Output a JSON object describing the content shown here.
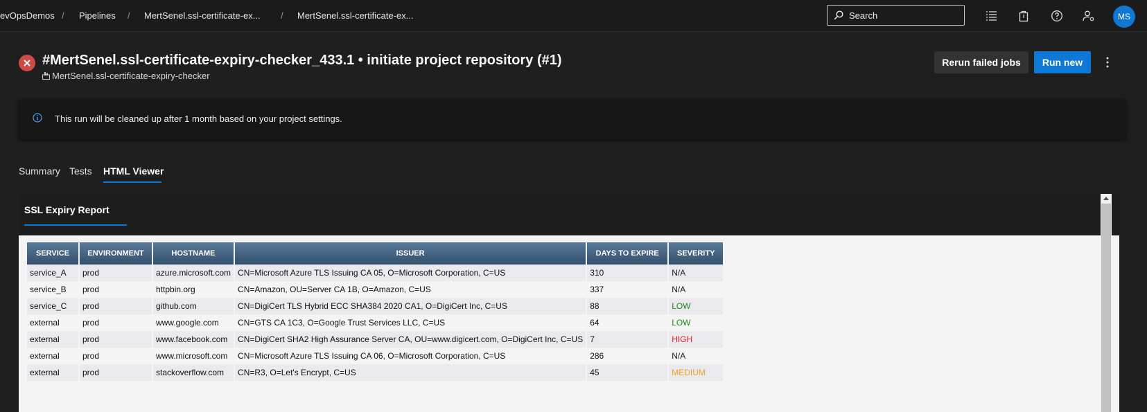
{
  "breadcrumb": {
    "items": [
      "evOpsDemos",
      "Pipelines",
      "MertSenel.ssl-certificate-ex...",
      "MertSenel.ssl-certificate-ex..."
    ],
    "separator": "/"
  },
  "topbar": {
    "search_label": "Search",
    "icons": [
      "list-settings-icon",
      "shopping-bag-icon",
      "help-icon",
      "user-settings-icon"
    ],
    "avatar_initials": "MS"
  },
  "run": {
    "status": "failed",
    "title": "#MertSenel.ssl-certificate-expiry-checker_433.1 • initiate project repository (#1)",
    "repo": "MertSenel.ssl-certificate-expiry-checker"
  },
  "actions": {
    "rerun_label": "Rerun failed jobs",
    "run_new_label": "Run new"
  },
  "banner": {
    "message": "This run will be cleaned up after 1 month based on your project settings."
  },
  "tabs": [
    {
      "label": "Summary",
      "active": false
    },
    {
      "label": "Tests",
      "active": false
    },
    {
      "label": "HTML Viewer",
      "active": true
    }
  ],
  "report": {
    "title": "SSL Expiry Report",
    "columns": [
      "SERVICE",
      "ENVIRONMENT",
      "HOSTNAME",
      "ISSUER",
      "DAYS TO EXPIRE",
      "SEVERITY"
    ],
    "rows": [
      [
        "service_A",
        "prod",
        "azure.microsoft.com",
        "CN=Microsoft Azure TLS Issuing CA 05, O=Microsoft Corporation, C=US",
        "310",
        "N/A"
      ],
      [
        "service_B",
        "prod",
        "httpbin.org",
        "CN=Amazon, OU=Server CA 1B, O=Amazon, C=US",
        "337",
        "N/A"
      ],
      [
        "service_C",
        "prod",
        "github.com",
        "CN=DigiCert TLS Hybrid ECC SHA384 2020 CA1, O=DigiCert Inc, C=US",
        "88",
        "LOW"
      ],
      [
        "external",
        "prod",
        "www.google.com",
        "CN=GTS CA 1C3, O=Google Trust Services LLC, C=US",
        "64",
        "LOW"
      ],
      [
        "external",
        "prod",
        "www.facebook.com",
        "CN=DigiCert SHA2 High Assurance Server CA, OU=www.digicert.com, O=DigiCert Inc, C=US",
        "7",
        "HIGH"
      ],
      [
        "external",
        "prod",
        "www.microsoft.com",
        "CN=Microsoft Azure TLS Issuing CA 06, O=Microsoft Corporation, C=US",
        "286",
        "N/A"
      ],
      [
        "external",
        "prod",
        "stackoverflow.com",
        "CN=R3, O=Let's Encrypt, C=US",
        "45",
        "MEDIUM"
      ]
    ],
    "severity_colors": {
      "N/A": "#222222",
      "LOW": "#1a8a1a",
      "MEDIUM": "#f0a020",
      "HIGH": "#e02020"
    }
  },
  "colors": {
    "accent": "#0f78d4",
    "error": "#cd4a45",
    "table_header": "#3f5f7f"
  }
}
